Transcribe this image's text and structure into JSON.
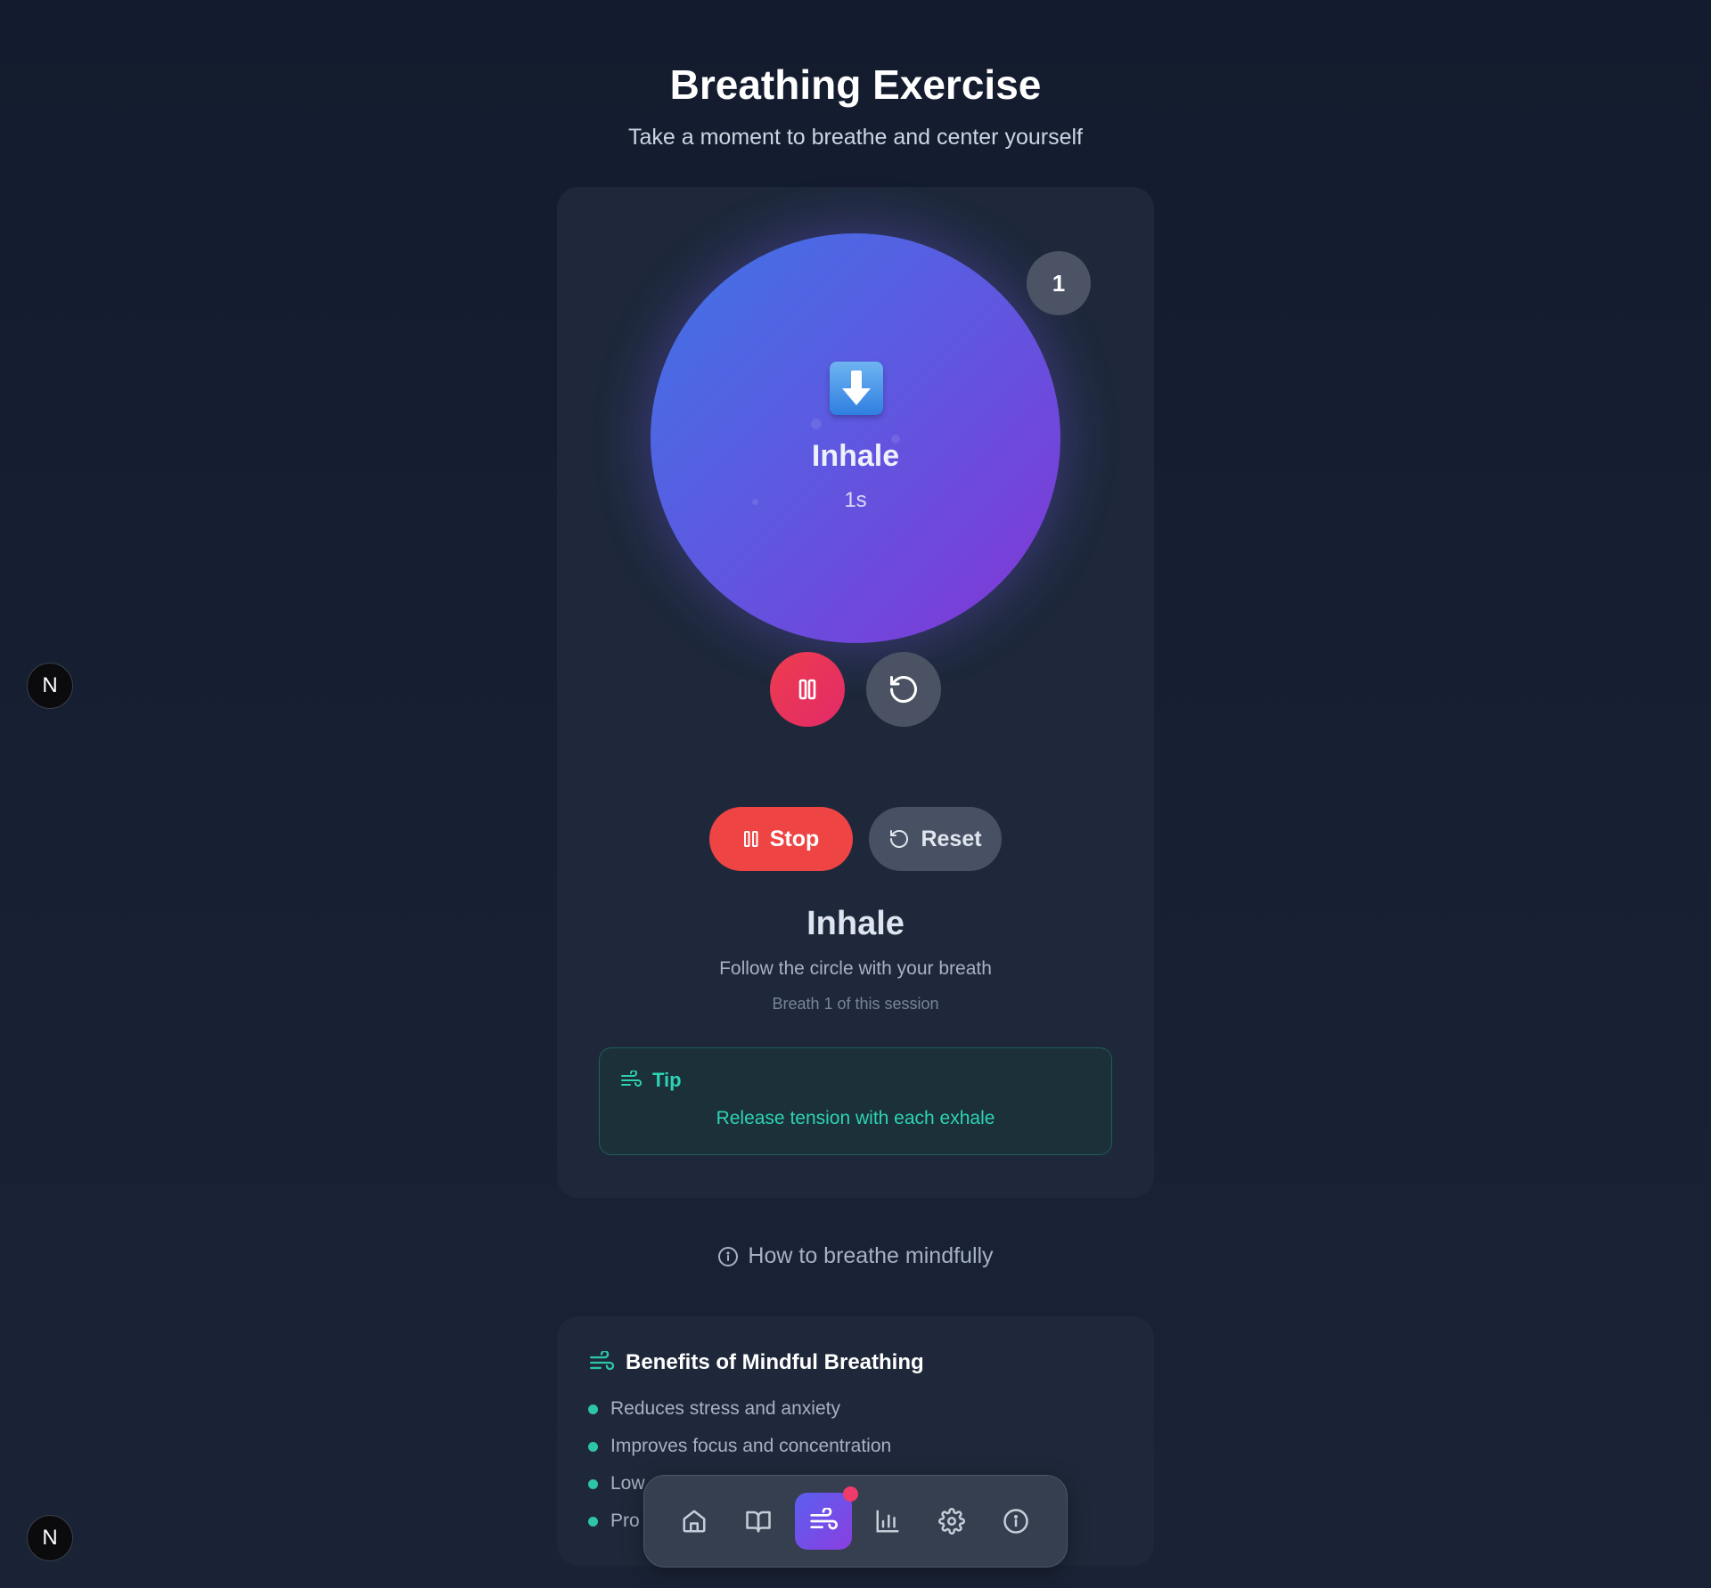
{
  "header": {
    "title": "Breathing Exercise",
    "subtitle": "Take a moment to breathe and center yourself"
  },
  "circle": {
    "icon": "down-arrow-emoji",
    "phase": "Inhale",
    "time": "1s",
    "breath_count": "1"
  },
  "controls": {
    "stop_label": "Stop",
    "reset_label": "Reset"
  },
  "status": {
    "phase": "Inhale",
    "instruction": "Follow the circle with your breath",
    "breath_info": "Breath 1 of this session"
  },
  "tip": {
    "label": "Tip",
    "text": "Release tension with each exhale"
  },
  "howto": {
    "label": "How to breathe mindfully"
  },
  "benefits": {
    "title": "Benefits of Mindful Breathing",
    "items": [
      "Reduces stress and anxiety",
      "Improves focus and concentration",
      "Low",
      "Pro"
    ]
  },
  "nav": {
    "items": [
      "home-icon",
      "book-icon",
      "wind-icon",
      "chart-icon",
      "gear-icon",
      "info-icon"
    ],
    "active": "wind-icon"
  },
  "badges": {
    "n_label": "N"
  },
  "colors": {
    "accent": "#6366f1",
    "stop": "#ef4444",
    "tip": "#2ed3b4",
    "notification": "#ef3b6b"
  }
}
